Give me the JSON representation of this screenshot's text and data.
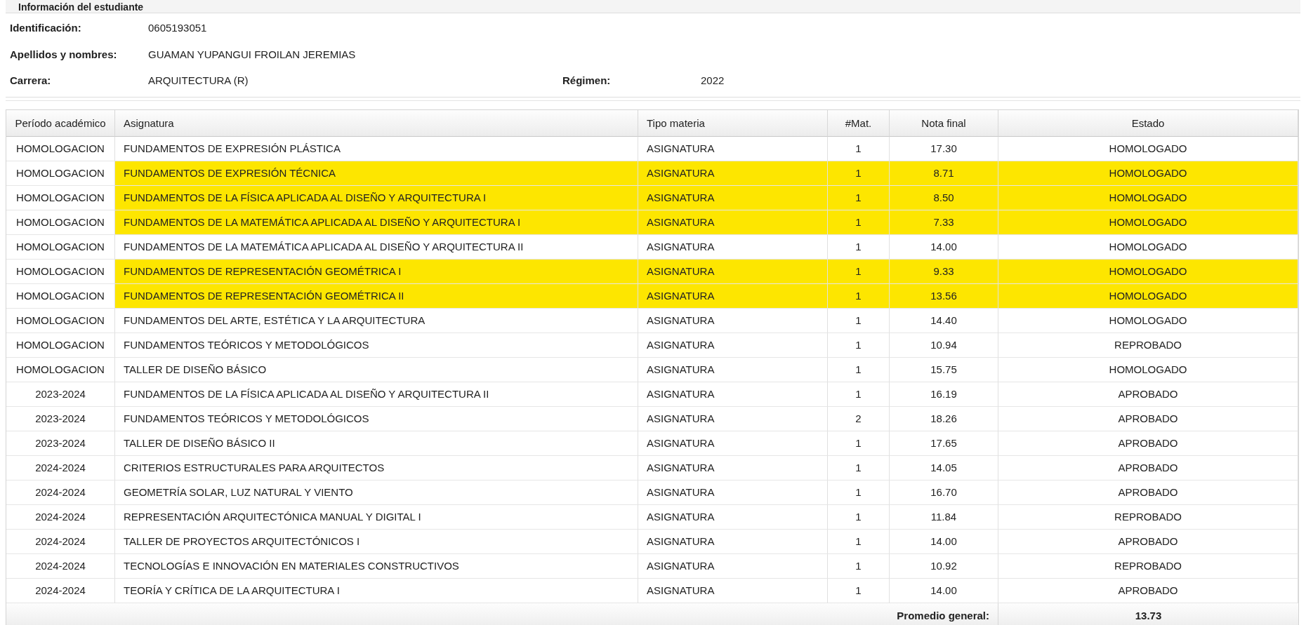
{
  "section_title": "Información del estudiante",
  "student": {
    "fields": [
      {
        "label": "Identificación:",
        "value": "0605193051"
      },
      {
        "label": "Apellidos y nombres:",
        "value": "GUAMAN YUPANGUI FROILAN JEREMIAS"
      },
      {
        "label": "Carrera:",
        "value": "ARQUITECTURA (R)"
      }
    ],
    "extra_field": {
      "label": "Régimen:",
      "value": "2022"
    }
  },
  "table": {
    "columns": [
      "Período académico",
      "Asignatura",
      "Tipo materia",
      "#Mat.",
      "Nota final",
      "Estado"
    ],
    "rows": [
      {
        "period": "HOMOLOGACION",
        "subject": "FUNDAMENTOS DE EXPRESIÓN PLÁSTICA",
        "type": "ASIGNATURA",
        "mat": "1",
        "grade": "17.30",
        "status": "HOMOLOGADO",
        "highlighted": false
      },
      {
        "period": "HOMOLOGACION",
        "subject": "FUNDAMENTOS DE EXPRESIÓN TÉCNICA",
        "type": "ASIGNATURA",
        "mat": "1",
        "grade": "8.71",
        "status": "HOMOLOGADO",
        "highlighted": true
      },
      {
        "period": "HOMOLOGACION",
        "subject": "FUNDAMENTOS DE LA FÍSICA APLICADA AL DISEÑO Y ARQUITECTURA I",
        "type": "ASIGNATURA",
        "mat": "1",
        "grade": "8.50",
        "status": "HOMOLOGADO",
        "highlighted": true
      },
      {
        "period": "HOMOLOGACION",
        "subject": "FUNDAMENTOS DE LA MATEMÁTICA APLICADA AL DISEÑO Y ARQUITECTURA I",
        "type": "ASIGNATURA",
        "mat": "1",
        "grade": "7.33",
        "status": "HOMOLOGADO",
        "highlighted": true
      },
      {
        "period": "HOMOLOGACION",
        "subject": "FUNDAMENTOS DE LA MATEMÁTICA APLICADA AL DISEÑO Y ARQUITECTURA II",
        "type": "ASIGNATURA",
        "mat": "1",
        "grade": "14.00",
        "status": "HOMOLOGADO",
        "highlighted": false
      },
      {
        "period": "HOMOLOGACION",
        "subject": "FUNDAMENTOS DE REPRESENTACIÓN GEOMÉTRICA I",
        "type": "ASIGNATURA",
        "mat": "1",
        "grade": "9.33",
        "status": "HOMOLOGADO",
        "highlighted": true
      },
      {
        "period": "HOMOLOGACION",
        "subject": "FUNDAMENTOS DE REPRESENTACIÓN GEOMÉTRICA II",
        "type": "ASIGNATURA",
        "mat": "1",
        "grade": "13.56",
        "status": "HOMOLOGADO",
        "highlighted": true
      },
      {
        "period": "HOMOLOGACION",
        "subject": "FUNDAMENTOS DEL ARTE, ESTÉTICA Y LA ARQUITECTURA",
        "type": "ASIGNATURA",
        "mat": "1",
        "grade": "14.40",
        "status": "HOMOLOGADO",
        "highlighted": false
      },
      {
        "period": "HOMOLOGACION",
        "subject": "FUNDAMENTOS TEÓRICOS Y METODOLÓGICOS",
        "type": "ASIGNATURA",
        "mat": "1",
        "grade": "10.94",
        "status": "REPROBADO",
        "highlighted": false
      },
      {
        "period": "HOMOLOGACION",
        "subject": "TALLER DE DISEÑO BÁSICO",
        "type": "ASIGNATURA",
        "mat": "1",
        "grade": "15.75",
        "status": "HOMOLOGADO",
        "highlighted": false
      },
      {
        "period": "2023-2024",
        "subject": "FUNDAMENTOS DE LA FÍSICA APLICADA AL DISEÑO Y ARQUITECTURA II",
        "type": "ASIGNATURA",
        "mat": "1",
        "grade": "16.19",
        "status": "APROBADO",
        "highlighted": false
      },
      {
        "period": "2023-2024",
        "subject": "FUNDAMENTOS TEÓRICOS Y METODOLÓGICOS",
        "type": "ASIGNATURA",
        "mat": "2",
        "grade": "18.26",
        "status": "APROBADO",
        "highlighted": false
      },
      {
        "period": "2023-2024",
        "subject": "TALLER DE DISEÑO BÁSICO II",
        "type": "ASIGNATURA",
        "mat": "1",
        "grade": "17.65",
        "status": "APROBADO",
        "highlighted": false
      },
      {
        "period": "2024-2024",
        "subject": "CRITERIOS ESTRUCTURALES PARA ARQUITECTOS",
        "type": "ASIGNATURA",
        "mat": "1",
        "grade": "14.05",
        "status": "APROBADO",
        "highlighted": false
      },
      {
        "period": "2024-2024",
        "subject": "GEOMETRÍA SOLAR, LUZ NATURAL Y VIENTO",
        "type": "ASIGNATURA",
        "mat": "1",
        "grade": "16.70",
        "status": "APROBADO",
        "highlighted": false
      },
      {
        "period": "2024-2024",
        "subject": "REPRESENTACIÓN ARQUITECTÓNICA MANUAL Y DIGITAL I",
        "type": "ASIGNATURA",
        "mat": "1",
        "grade": "11.84",
        "status": "REPROBADO",
        "highlighted": false
      },
      {
        "period": "2024-2024",
        "subject": "TALLER DE PROYECTOS ARQUITECTÓNICOS I",
        "type": "ASIGNATURA",
        "mat": "1",
        "grade": "14.00",
        "status": "APROBADO",
        "highlighted": false
      },
      {
        "period": "2024-2024",
        "subject": "TECNOLOGÍAS E INNOVACIÓN EN MATERIALES CONSTRUCTIVOS",
        "type": "ASIGNATURA",
        "mat": "1",
        "grade": "10.92",
        "status": "REPROBADO",
        "highlighted": false
      },
      {
        "period": "2024-2024",
        "subject": "TEORÍA Y CRÍTICA DE LA ARQUITECTURA I",
        "type": "ASIGNATURA",
        "mat": "1",
        "grade": "14.00",
        "status": "APROBADO",
        "highlighted": false
      }
    ],
    "footer": {
      "label": "Promedio general:",
      "value": "13.73"
    }
  }
}
